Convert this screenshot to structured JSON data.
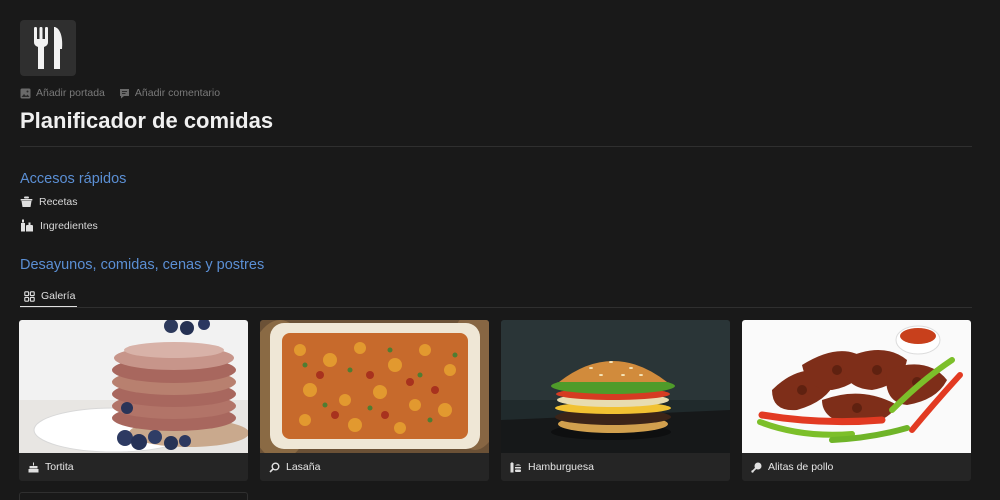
{
  "page": {
    "icon": "fork-knife-icon",
    "add_cover_label": "Añadir portada",
    "add_comment_label": "Añadir comentario",
    "title": "Planificador de comidas"
  },
  "quick_access": {
    "heading": "Accesos rápidos",
    "links": [
      {
        "label": "Recetas",
        "icon": "pot-icon"
      },
      {
        "label": "Ingredientes",
        "icon": "bottles-icon"
      }
    ]
  },
  "meals": {
    "heading": "Desayunos, comidas, cenas y postres",
    "view_tab": {
      "label": "Galería",
      "icon": "gallery-grid-icon"
    },
    "cards": [
      {
        "title": "Tortita",
        "icon": "cake-icon"
      },
      {
        "title": "Lasaña",
        "icon": "magnifier-icon"
      },
      {
        "title": "Hamburguesa",
        "icon": "burger-icon"
      },
      {
        "title": "Alitas de pollo",
        "icon": "drumstick-icon"
      }
    ]
  },
  "colors": {
    "background": "#191919",
    "accent_heading": "#5b8fd4",
    "card_background": "#252525"
  }
}
